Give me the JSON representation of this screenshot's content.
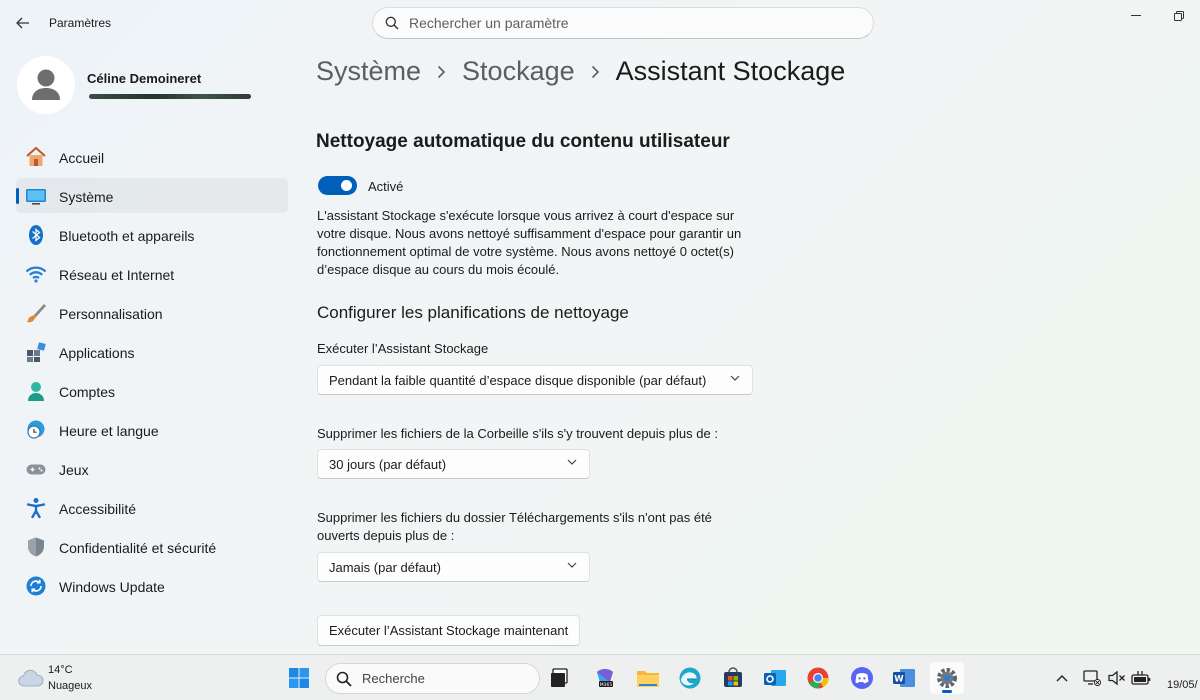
{
  "window": {
    "title": "Paramètres",
    "search_placeholder": "Rechercher un paramètre"
  },
  "user": {
    "name": "Céline Demoineret"
  },
  "sidebar": {
    "items": [
      {
        "label": "Accueil",
        "icon": "home-icon"
      },
      {
        "label": "Système",
        "icon": "system-display-icon",
        "active": true
      },
      {
        "label": "Bluetooth et appareils",
        "icon": "bluetooth-icon"
      },
      {
        "label": "Réseau et Internet",
        "icon": "wifi-icon"
      },
      {
        "label": "Personnalisation",
        "icon": "paintbrush-icon"
      },
      {
        "label": "Applications",
        "icon": "apps-icon"
      },
      {
        "label": "Comptes",
        "icon": "account-icon"
      },
      {
        "label": "Heure et langue",
        "icon": "clock-globe-icon"
      },
      {
        "label": "Jeux",
        "icon": "gamepad-icon"
      },
      {
        "label": "Accessibilité",
        "icon": "accessibility-icon"
      },
      {
        "label": "Confidentialité et sécurité",
        "icon": "shield-icon"
      },
      {
        "label": "Windows Update",
        "icon": "windows-update-icon"
      }
    ]
  },
  "breadcrumb": [
    "Système",
    "Stockage",
    "Assistant Stockage"
  ],
  "content": {
    "section_title": "Nettoyage automatique du contenu utilisateur",
    "toggle_label": "Activé",
    "toggle_on": true,
    "description": "L'assistant Stockage s'exécute lorsque vous arrivez à court d'espace sur votre disque. Nous avons nettoyé suffisamment d'espace pour garantir un fonctionnement optimal de votre système. Nous avons nettoyé 0 octet(s) d’espace disque au cours du mois écoulé.",
    "subheading": "Configurer les planifications de nettoyage",
    "run_label": "Exécuter l’Assistant Stockage",
    "run_value": "Pendant la faible quantité d’espace disque disponible (par défaut)",
    "recycle_label": "Supprimer les fichiers de la Corbeille s'ils s'y trouvent depuis plus de :",
    "recycle_value": "30 jours (par défaut)",
    "downloads_label": "Supprimer les fichiers du dossier Téléchargements s'ils n'ont pas été ouverts depuis plus de :",
    "downloads_value": "Jamais (par défaut)",
    "run_now_button": "Exécuter l’Assistant Stockage maintenant"
  },
  "taskbar": {
    "weather_temp": "14°C",
    "weather_condition": "Nuageux",
    "search_label": "Recherche",
    "apps": [
      "windows-start-icon",
      "task-view-icon",
      "microsoft-365-icon",
      "file-explorer-icon",
      "edge-icon",
      "microsoft-store-icon",
      "outlook-icon",
      "chrome-icon",
      "discord-icon",
      "word-icon",
      "settings-gear-icon"
    ],
    "date": "19/05/"
  },
  "colors": {
    "accent": "#005fb8"
  }
}
